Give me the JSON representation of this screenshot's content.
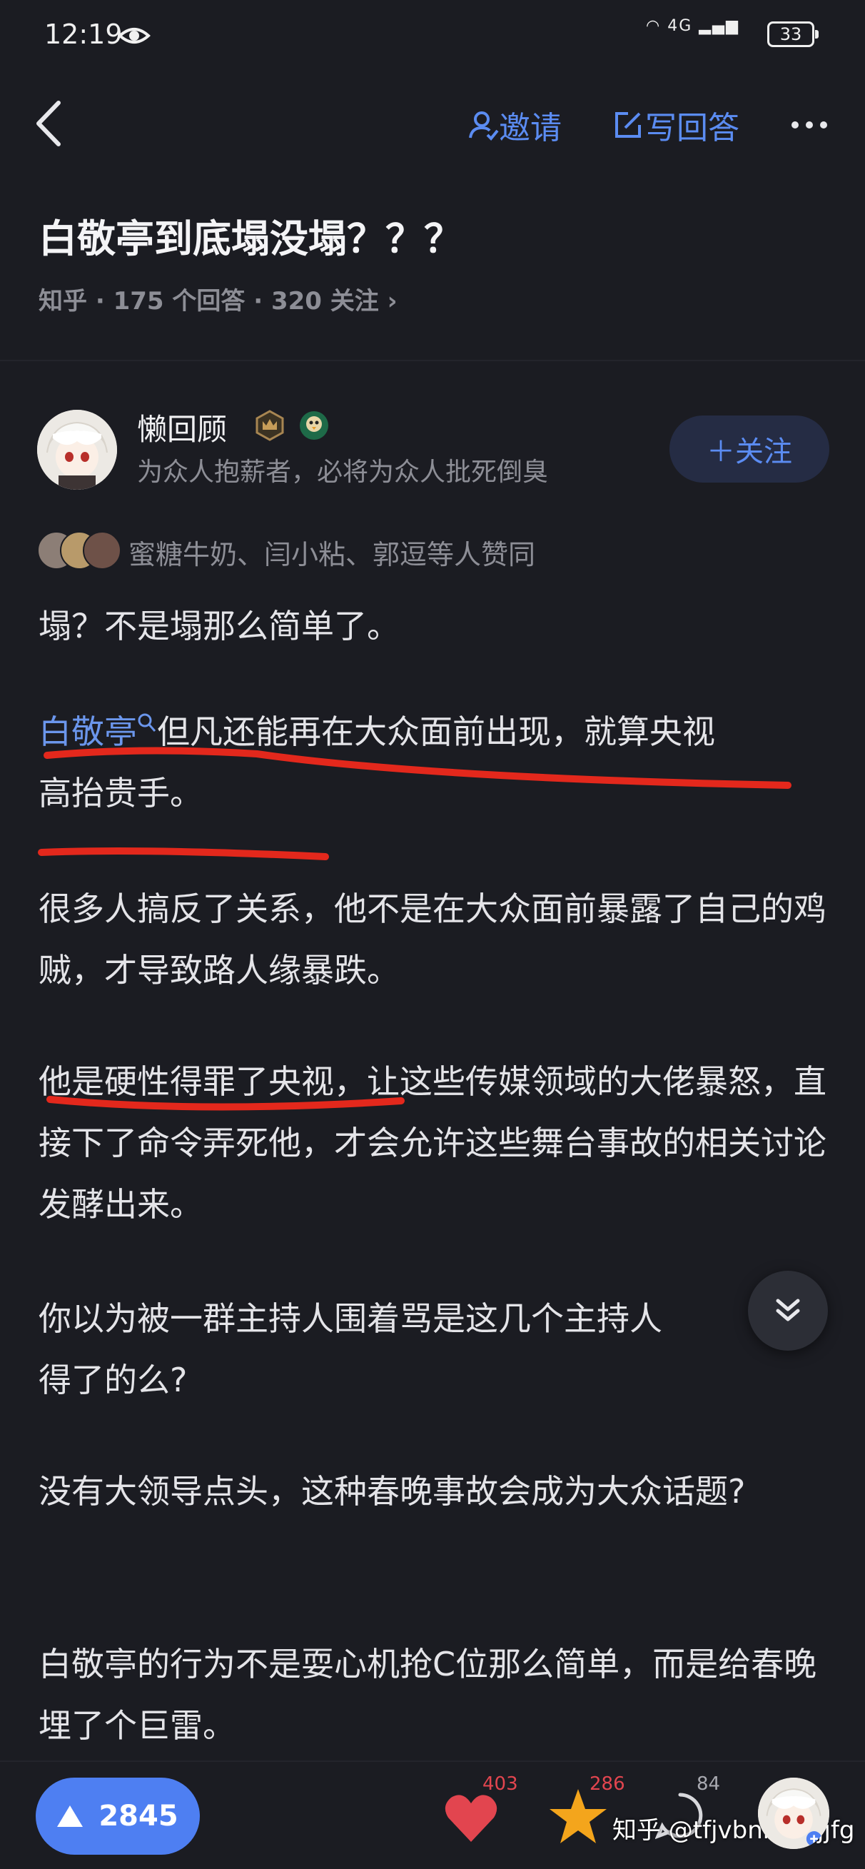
{
  "status_bar": {
    "time": "12:19",
    "network": "4G",
    "battery": "33"
  },
  "nav": {
    "invite_label": "邀请",
    "write_answer_label": "写回答"
  },
  "question": {
    "title": "白敬亭到底塌没塌？？？",
    "meta": "知乎 · 175 个回答 · 320 关注 ›"
  },
  "author": {
    "name": "懒回顾",
    "bio": "为众人抱薪者，必将为众人批死倒臭",
    "follow_label": "＋关注"
  },
  "likers_text": "蜜糖牛奶、闫小粘、郭逗等人赞同",
  "answer": {
    "p1": "塌？不是塌那么简单了。",
    "p2_link": "白敬亭",
    "p2_rest_line1": "但凡还能再在大众面前出现，就算央视",
    "p2_rest_line2": "高抬贵手。",
    "p3": "很多人搞反了关系，他不是在大众面前暴露了自己的鸡贼，才导致路人缘暴跌。",
    "p4": "他是硬性得罪了央视，让这些传媒领域的大佬暴怒，直接下了命令弄死他，才会允许这些舞台事故的相关讨论发酵出来。",
    "p5_line1": "你以为被一群主持人围着骂是这几个主持人",
    "p5_line2": "得了的么?",
    "p6": "没有大领导点头，这种春晚事故会成为大众话题?",
    "p7": "白敬亭的行为不是耍心机抢C位那么简单，而是给春晚埋了个巨雷。"
  },
  "bottom_bar": {
    "upvote_count": "2845",
    "like_count": "403",
    "favorite_count": "286",
    "comment_count": "84",
    "watermark": "知乎 @tfjvbnmghjjfg"
  },
  "colors": {
    "accent": "#5b8cf2",
    "background": "#1b1c22",
    "highlight_red": "#e3281c"
  }
}
